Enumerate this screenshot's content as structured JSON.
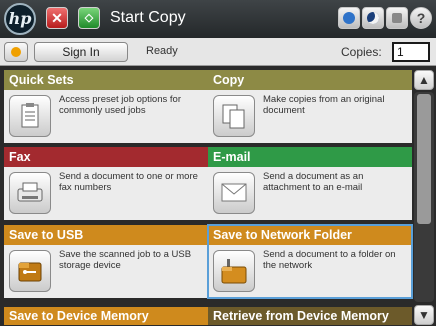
{
  "topbar": {
    "logo": "hp",
    "title": "Start Copy",
    "icons": [
      "stop-icon",
      "start-icon",
      "network-icon",
      "sleep-icon",
      "language-icon",
      "help-icon"
    ],
    "help_symbol": "?"
  },
  "statusbar": {
    "sign_in": "Sign In",
    "status": "Ready",
    "copies_label": "Copies:",
    "copies_value": "1"
  },
  "tiles": [
    {
      "title": "Quick Sets",
      "desc": "Access preset job options for commonly used jobs",
      "color": "#8d8a45",
      "icon": "quick-sets-icon"
    },
    {
      "title": "Copy",
      "desc": "Make copies from an original document",
      "color": "#8d8a45",
      "icon": "copy-icon"
    },
    {
      "title": "Fax",
      "desc": "Send a document to one or more fax numbers",
      "color": "#a32a2f",
      "icon": "fax-icon"
    },
    {
      "title": "E-mail",
      "desc": "Send a document as an attachment to an e-mail",
      "color": "#2f9a47",
      "icon": "email-icon"
    },
    {
      "title": "Save to USB",
      "desc": "Save the scanned job to a USB storage device",
      "color": "#cf8a1d",
      "icon": "usb-icon"
    },
    {
      "title": "Save to Network Folder",
      "desc": "Send a document to a folder on the network",
      "color": "#cf8a1d",
      "icon": "network-folder-icon"
    }
  ],
  "bottom": {
    "left": "Save to Device Memory",
    "right": "Retrieve from Device Memory",
    "left_color": "#cf8a1d",
    "right_color": "#6c5a2a"
  },
  "scroll": {
    "up": "▲",
    "down": "▼"
  }
}
